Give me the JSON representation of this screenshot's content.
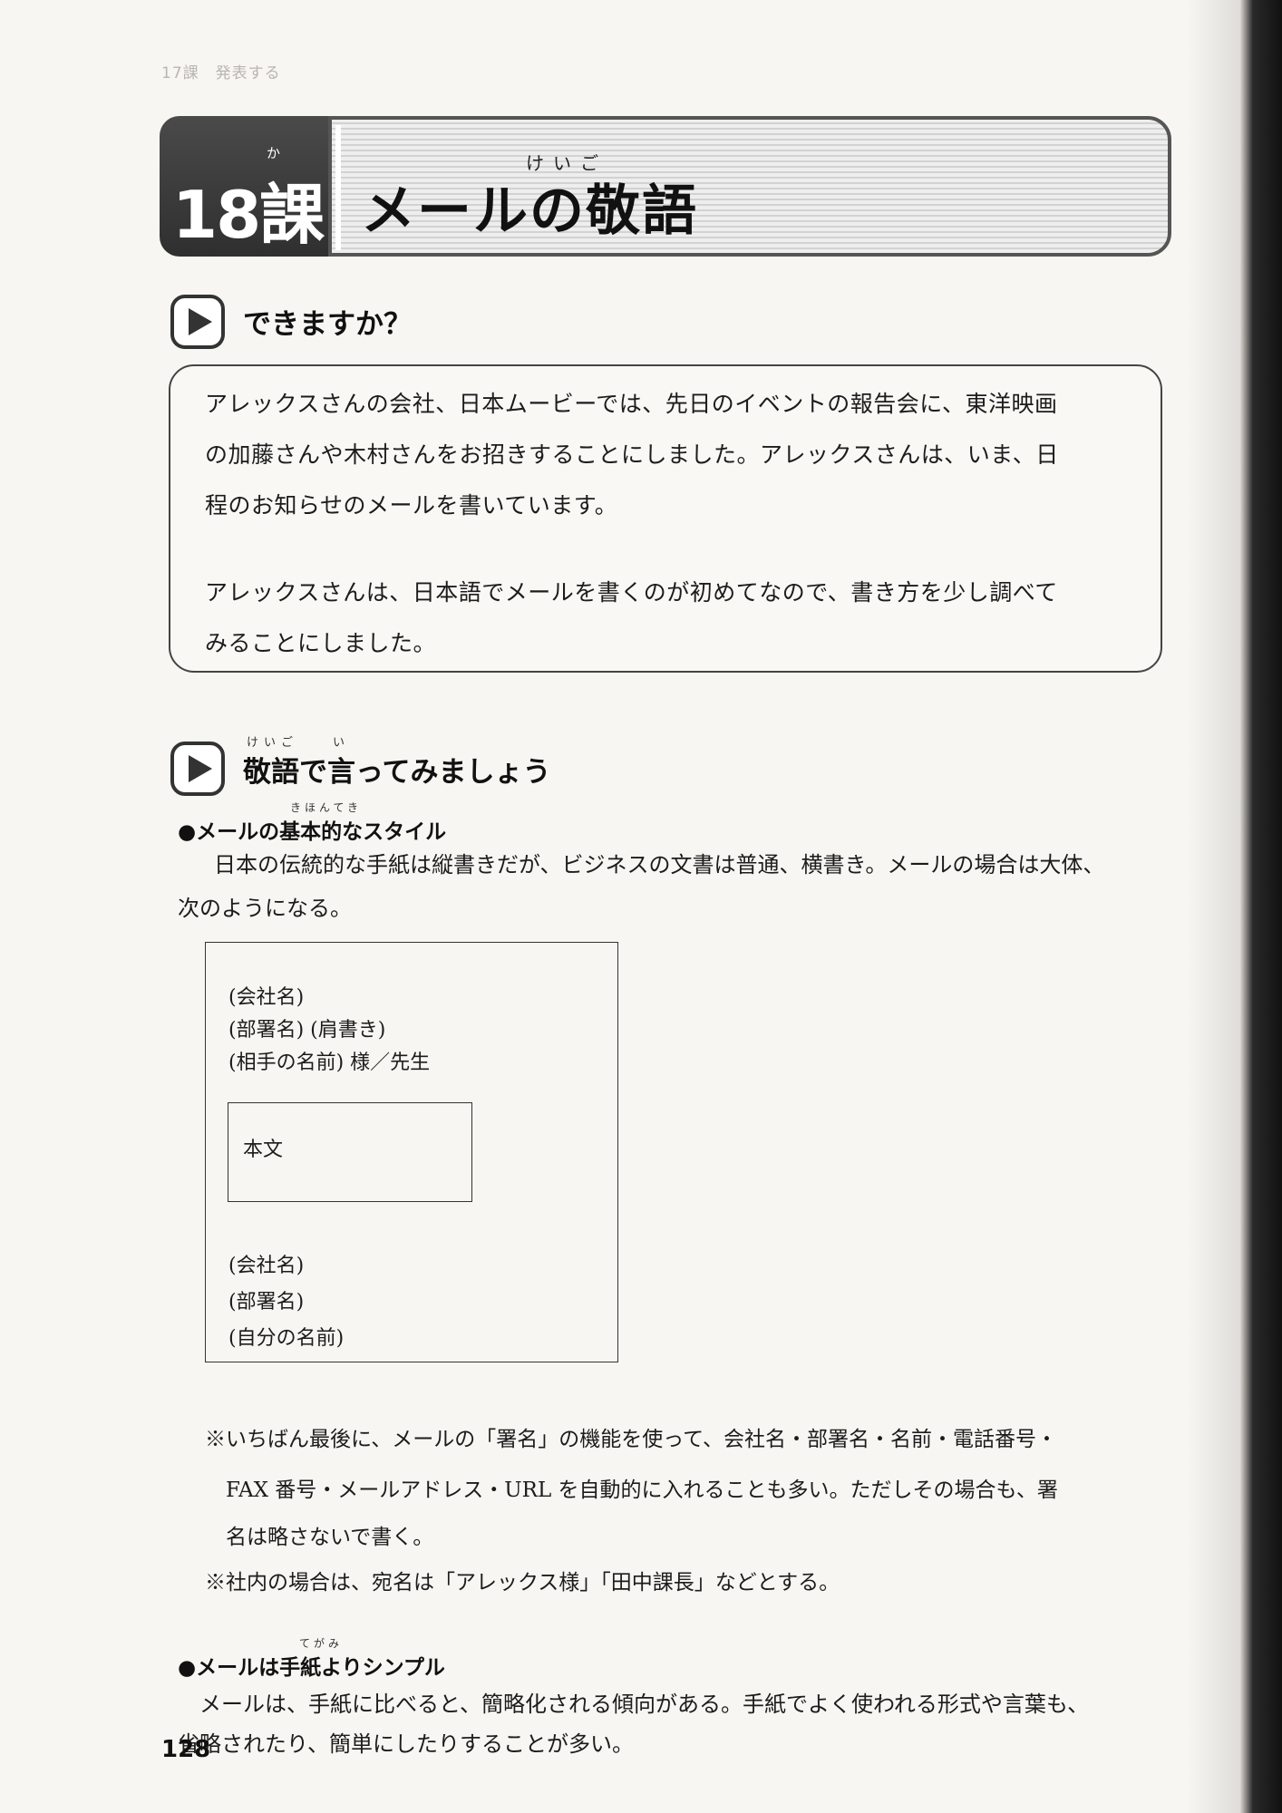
{
  "running_head": "17課　発表する",
  "lesson": {
    "number": "18課",
    "ruby": "か",
    "title": "メールの敬語",
    "title_ruby": "けいご"
  },
  "section1": {
    "heading": "できますか？",
    "para1": [
      "アレックスさんの会社、日本ムービーでは、先日のイベントの報告会に、東洋映画",
      "の加藤さんや木村さんをお招きすることにしました。アレックスさんは、いま、日",
      "程のお知らせのメールを書いています。"
    ],
    "para2": [
      "アレックスさんは、日本語でメールを書くのが初めてなので、書き方を少し調べて",
      "みることにしました。"
    ]
  },
  "section2": {
    "heading": "敬語で言ってみましょう",
    "heading_ruby": "けいご　　い",
    "sub1": "●メールの基本的なスタイル",
    "sub1_ruby": "きほんてき",
    "sub1_body": [
      "日本の伝統的な手紙は縦書きだが、ビジネスの文書は普通、横書き。メールの場合は大体、",
      "次のようになる。"
    ],
    "letter": {
      "company": "(会社名)",
      "dept_title": "(部署名) (肩書き)",
      "recipient": "(相手の名前) 様／先生",
      "body": "本文",
      "sig_company": "(会社名)",
      "sig_dept": "(部署名)",
      "sig_name": "(自分の名前)"
    },
    "note1": [
      "※いちばん最後に、メールの「署名」の機能を使って、会社名・部署名・名前・電話番号・",
      "　FAX 番号・メールアドレス・URL を自動的に入れることも多い。ただしその場合も、署",
      "　名は略さないで書く。"
    ],
    "note2": "※社内の場合は、宛名は「アレックス様」「田中課長」などとする。",
    "sub2": "●メールは手紙よりシンプル",
    "sub2_ruby": "てがみ",
    "sub2_body": [
      "　メールは、手紙に比べると、簡略化される傾向がある。手紙でよく使われる形式や言葉も、",
      "省略されたり、簡単にしたりすることが多い。"
    ]
  },
  "page_number": "128"
}
